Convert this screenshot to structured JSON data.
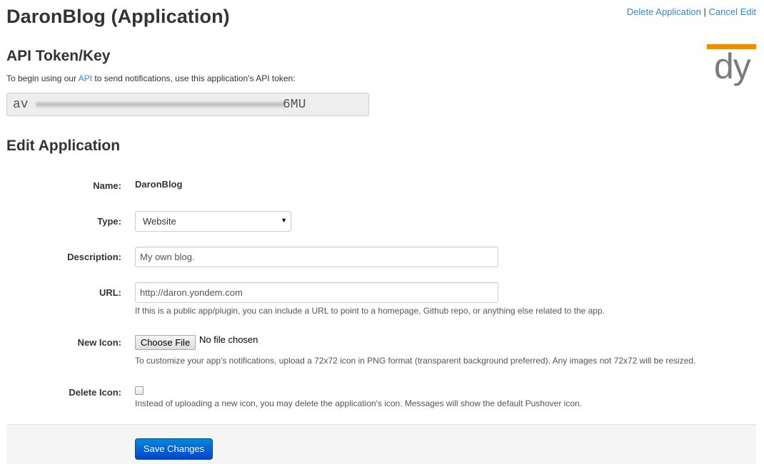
{
  "header": {
    "title": "DaronBlog (Application)",
    "delete_link": "Delete Application",
    "separator": "|",
    "cancel_link": "Cancel Edit"
  },
  "logo": {
    "letters": "dy",
    "accent_color": "#f28b00"
  },
  "api_section": {
    "heading": "API Token/Key",
    "intro_before": "To begin using our ",
    "intro_link": "API",
    "intro_after": " to send notifications, use this application's API token:",
    "token_start": "av",
    "token_end": "6MU"
  },
  "edit_section": {
    "heading": "Edit Application",
    "name": {
      "label": "Name:",
      "value": "DaronBlog"
    },
    "type": {
      "label": "Type:",
      "selected": "Website"
    },
    "description": {
      "label": "Description:",
      "value": "My own blog."
    },
    "url": {
      "label": "URL:",
      "value": "http://daron.yondem.com",
      "help": "If this is a public app/plugin, you can include a URL to point to a homepage, Github repo, or anything else related to the app."
    },
    "new_icon": {
      "label": "New Icon:",
      "button": "Choose File",
      "status": "No file chosen",
      "help": "To customize your app's notifications, upload a 72x72 icon in PNG format (transparent background preferred). Any images not 72x72 will be resized."
    },
    "delete_icon": {
      "label": "Delete Icon:",
      "checked": false,
      "help": "Instead of uploading a new icon, you may delete the application's icon. Messages will show the default Pushover icon."
    }
  },
  "actions": {
    "save_label": "Save Changes",
    "accent_color": "#0055cc"
  }
}
